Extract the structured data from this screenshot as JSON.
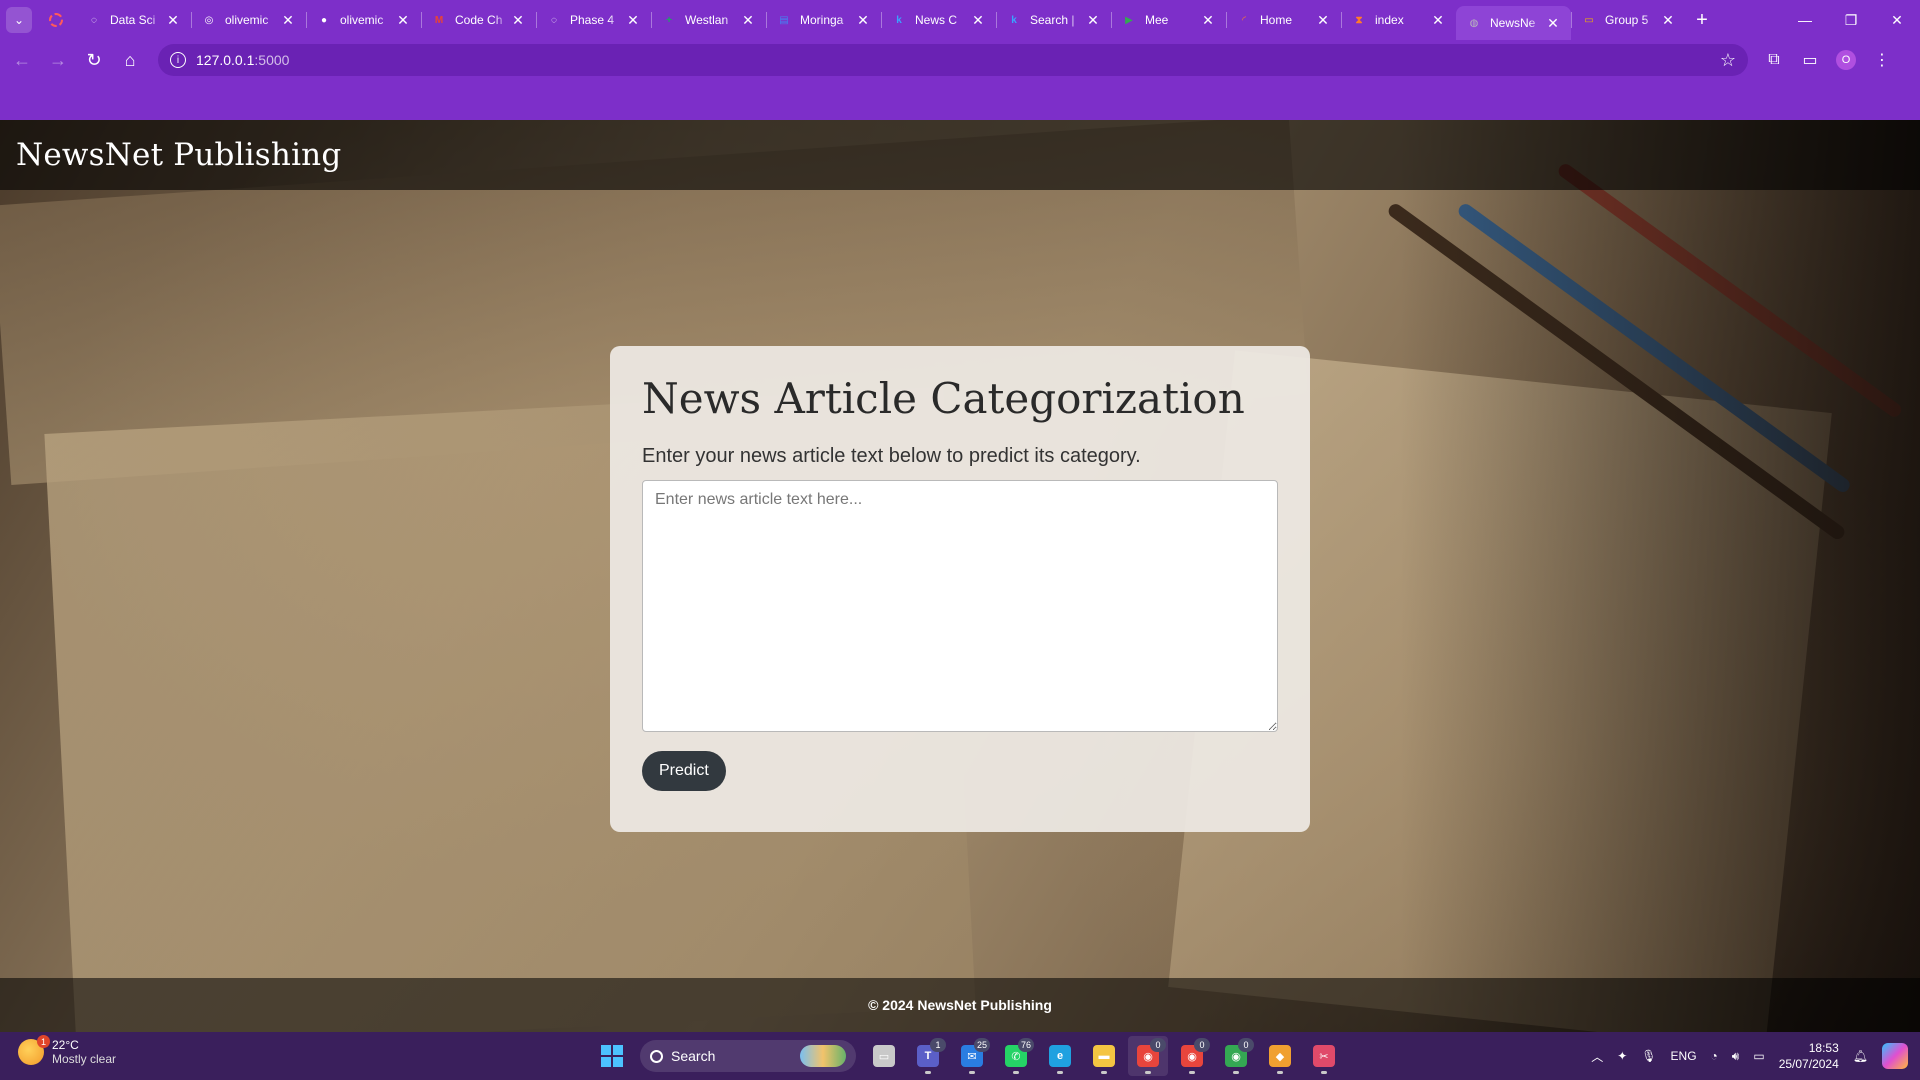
{
  "browser": {
    "tabs": [
      {
        "title": "Data Sci",
        "fav_color": "#ffffff",
        "fav_glyph": "◌"
      },
      {
        "title": "olivemic",
        "fav_color": "#ffffff",
        "fav_glyph": "◎"
      },
      {
        "title": "olivemic",
        "fav_color": "#ffffff",
        "fav_glyph": "●"
      },
      {
        "title": "Code Ch",
        "fav_color": "#ea4335",
        "fav_glyph": "M"
      },
      {
        "title": "Phase 4",
        "fav_color": "#ffffff",
        "fav_glyph": "◌"
      },
      {
        "title": "Westlan",
        "fav_color": "#1ea362",
        "fav_glyph": "+"
      },
      {
        "title": "Moringa",
        "fav_color": "#4285f4",
        "fav_glyph": "▤"
      },
      {
        "title": "News C",
        "fav_color": "#3aa3ff",
        "fav_glyph": "k"
      },
      {
        "title": "Search |",
        "fav_color": "#3aa3ff",
        "fav_glyph": "k"
      },
      {
        "title": "Mee",
        "fav_color": "#34a853",
        "fav_glyph": "▶"
      },
      {
        "title": "Home",
        "fav_color": "#ff7a2a",
        "fav_glyph": "◜"
      },
      {
        "title": "index",
        "fav_color": "#ff7a2a",
        "fav_glyph": "⧗"
      },
      {
        "title": "NewsNe",
        "fav_color": "#bbbbbb",
        "fav_glyph": "◍",
        "active": true
      },
      {
        "title": "Group 5",
        "fav_color": "#f4b400",
        "fav_glyph": "▭"
      }
    ],
    "close_glyph": "✕",
    "new_tab_glyph": "+",
    "window_controls": {
      "minimize": "—",
      "maximize": "❐",
      "close": "✕"
    },
    "nav": {
      "back": "←",
      "forward": "→",
      "reload": "↻",
      "home": "⌂"
    },
    "url": {
      "host": "127.0.0.1",
      "port": ":5000"
    },
    "toolbar_right": {
      "bookmark": "☆",
      "extensions": "⧉",
      "cast": "▭",
      "profile": "O",
      "menu": "⋮"
    }
  },
  "site": {
    "brand": "NewsNet Publishing",
    "card": {
      "title": "News Article Categorization",
      "subtitle": "Enter your news article text below to predict its category.",
      "textarea_placeholder": "Enter news article text here...",
      "predict_label": "Predict"
    },
    "footer": "© 2024 NewsNet Publishing"
  },
  "taskbar": {
    "weather": {
      "temp": "22°C",
      "condition": "Mostly clear",
      "badge": "1"
    },
    "search_label": "Search",
    "apps": [
      {
        "name": "task-view-icon",
        "color": "#c9c9c9",
        "glyph": "▭"
      },
      {
        "name": "teams-icon",
        "color": "#5b5fc7",
        "glyph": "T",
        "count": "1"
      },
      {
        "name": "mail-icon",
        "color": "#2a7de1",
        "glyph": "✉",
        "count": "25"
      },
      {
        "name": "whatsapp-icon",
        "color": "#25d366",
        "glyph": "✆",
        "count": "76"
      },
      {
        "name": "edge-icon",
        "color": "#1fa1e0",
        "glyph": "e"
      },
      {
        "name": "file-explorer-icon",
        "color": "#f4c542",
        "glyph": "▬"
      },
      {
        "name": "chrome-icon",
        "color": "#e8453c",
        "glyph": "◉",
        "count": "0",
        "active": true
      },
      {
        "name": "chrome-profile-2-icon",
        "color": "#e8453c",
        "glyph": "◉",
        "count": "0"
      },
      {
        "name": "chrome-profile-3-icon",
        "color": "#34a853",
        "glyph": "◉",
        "count": "0"
      },
      {
        "name": "git-icon",
        "color": "#f0a030",
        "glyph": "◆"
      },
      {
        "name": "snipping-tool-icon",
        "color": "#e04a6a",
        "glyph": "✂"
      }
    ],
    "tray": {
      "language": "ENG",
      "time": "18:53",
      "date": "25/07/2024"
    }
  }
}
